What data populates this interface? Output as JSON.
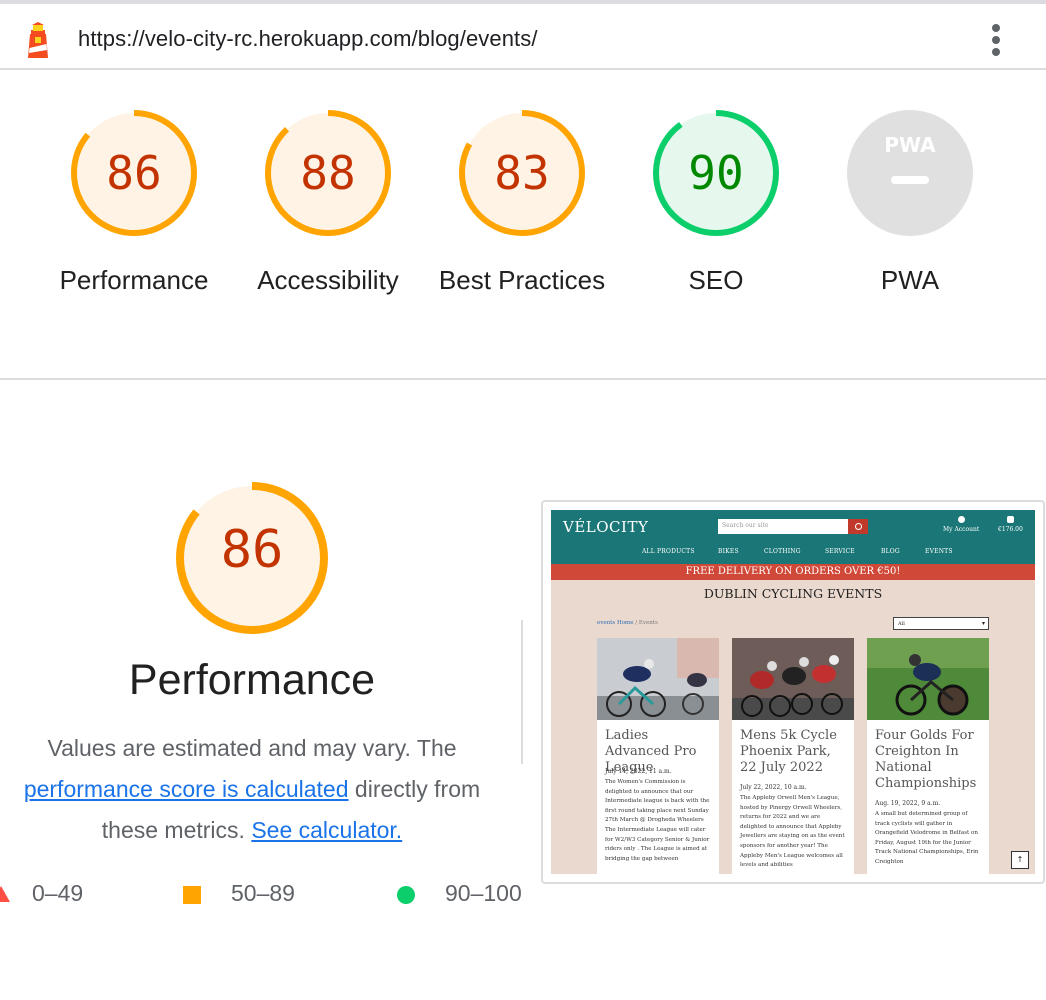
{
  "topbar": {
    "url": "https://velo-city-rc.herokuapp.com/blog/events/"
  },
  "scores": [
    {
      "label": "Performance",
      "value": "86",
      "score": 86,
      "color": "#ffa400",
      "text_color": "#c33300",
      "fill": "#fff3e5"
    },
    {
      "label": "Accessibility",
      "value": "88",
      "score": 88,
      "color": "#ffa400",
      "text_color": "#c33300",
      "fill": "#fff3e5"
    },
    {
      "label": "Best Practices",
      "value": "83",
      "score": 83,
      "color": "#ffa400",
      "text_color": "#c33300",
      "fill": "#fff3e5"
    },
    {
      "label": "SEO",
      "value": "90",
      "score": 90,
      "color": "#0cce6b",
      "text_color": "#008800",
      "fill": "#e6f8ee"
    },
    {
      "label": "PWA",
      "value": "",
      "score": null,
      "color": "#e0e0e0",
      "text_color": "#ffffff",
      "fill": "#e0e0e0",
      "badge": "PWA"
    }
  ],
  "performance": {
    "score_value": "86",
    "score": 86,
    "title": "Performance",
    "desc_prefix": "Values are estimated and may vary. The ",
    "desc_link1": "performance score is calculated",
    "desc_middle": " directly from these metrics. ",
    "desc_link2": "See calculator."
  },
  "legend": {
    "fail": "0–49",
    "average": "50–89",
    "pass": "90–100"
  },
  "thumbnail": {
    "logo": "VÉLOCITY",
    "search_placeholder": "Search our site",
    "account_label": "My Account",
    "cart_label": "€176.00",
    "nav": [
      "ALL PRODUCTS",
      "BIKES",
      "CLOTHING",
      "SERVICE",
      "BLOG",
      "EVENTS"
    ],
    "banner": "FREE DELIVERY ON ORDERS OVER €50!",
    "title": "DUBLIN CYCLING EVENTS",
    "crumb_home": "events Home",
    "crumb_sep": " / Events",
    "select_value": "All",
    "cards": [
      {
        "title": "Ladies Advanced Pro League",
        "date": "July 14, 2022, 11 a.m.",
        "body": "The Women's Commission is delighted to announce that our Intermediate league is back with the first round taking place next Sunday 27th March @ Drogheda Wheelers The Intermediate League will cater for W2/W3 Category Senior & Junior riders only . The League is aimed at bridging the gap between"
      },
      {
        "title": "Mens 5k Cycle Phoenix Park, 22 July 2022",
        "date": "July 22, 2022, 10 a.m.",
        "body": "The Appleby Orwell Men's League, hosted by Pinergy Orwell Wheelers, returns for 2022 and we are delighted to announce that Appleby Jewellers are staying on as the event sponsors for another year! The Appleby Men's League welcomes all levels and abilities"
      },
      {
        "title": "Four Golds For Creighton In National Championships",
        "date": "Aug. 19, 2022, 9 a.m.",
        "body": "A small but determined group of track cyclists will gather in Orangefield Velodrome in Belfast on Friday, August 19th for the Junior Track National Championships, Erin Creighton"
      }
    ],
    "back_to_top": "↑"
  }
}
